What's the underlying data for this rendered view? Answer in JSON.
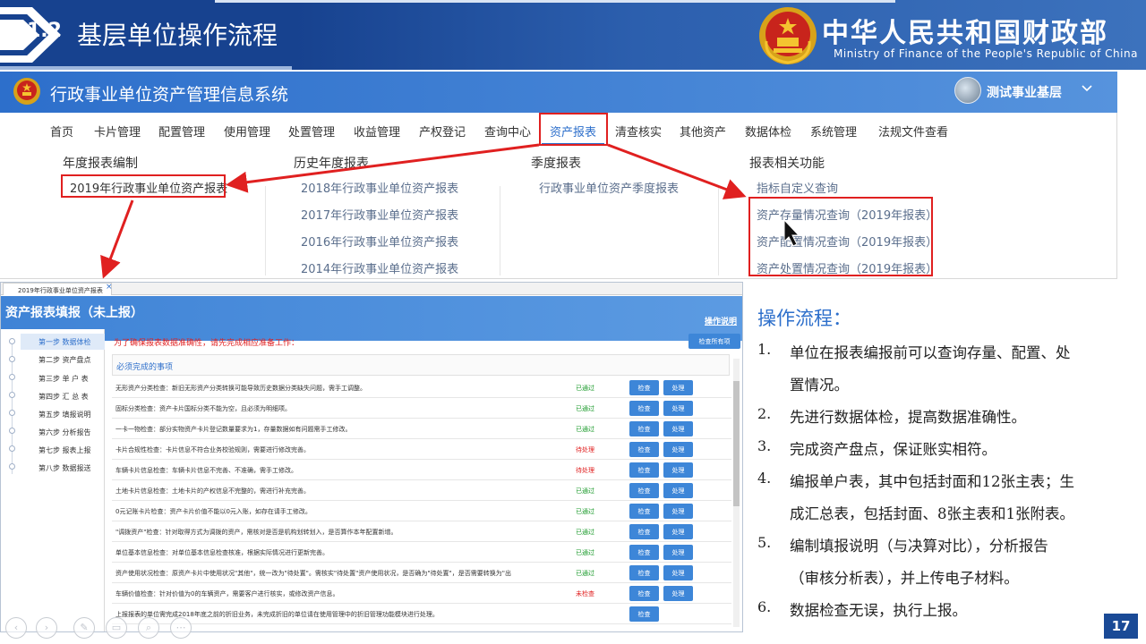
{
  "slide": {
    "section_number": "1.2",
    "section_title": "基层单位操作流程",
    "ministry_cn": "中华人民共和国财政部",
    "ministry_en": "Ministry of Finance of the People's Republic of China",
    "page_number": "17"
  },
  "system": {
    "title": "行政事业单位资产管理信息系统",
    "user_name": "测试事业基层",
    "nav": [
      "首页",
      "卡片管理",
      "配置管理",
      "使用管理",
      "处置管理",
      "收益管理",
      "产权登记",
      "查询中心",
      "资产报表",
      "清查核实",
      "其他资产",
      "数据体检",
      "系统管理",
      "法规文件查看"
    ],
    "active_nav": "资产报表",
    "dropdown": {
      "annual": {
        "heading": "年度报表编制",
        "links": [
          "2019年行政事业单位资产报表"
        ]
      },
      "history": {
        "heading": "历史年度报表",
        "links": [
          "2018年行政事业单位资产报表",
          "2017年行政事业单位资产报表",
          "2016年行政事业单位资产报表",
          "2014年行政事业单位资产报表"
        ]
      },
      "quarterly": {
        "heading": "季度报表",
        "links": [
          "行政事业单位资产季度报表"
        ]
      },
      "related": {
        "heading": "报表相关功能",
        "links": [
          "指标自定义查询",
          "资产存量情况查询（2019年报表）",
          "资产配置情况查询（2019年报表）",
          "资产处置情况查询（2019年报表）"
        ]
      }
    }
  },
  "report": {
    "tab_label": "2019年行政事业单位资产报表",
    "title": "资产报表填报（未上报）",
    "help": "操作说明",
    "warning": "为了确保报表数据准确性，请先完成相应准备工作：",
    "check_all": "检查所有项",
    "section_title": "必须完成的事项",
    "steps": [
      "第一步 数据体检",
      "第二步 资产盘点",
      "第三步 单 户 表",
      "第四步 汇 总 表",
      "第五步 填报说明",
      "第六步 分析报告",
      "第七步 报表上报",
      "第八步 数据报送"
    ],
    "check_label": "检查",
    "handle_label": "处理",
    "rows": [
      {
        "text": "无形资产分类检查：新旧无形资产分类转换可能导致历史数据分类缺失问题，需手工调整。",
        "status": "已通过",
        "status_color": "#1a9a2a",
        "handle": true
      },
      {
        "text": "固标分类检查：资产卡片国标分类不能为空，且必须为明细项。",
        "status": "已通过",
        "status_color": "#1a9a2a",
        "handle": true
      },
      {
        "text": "一卡一物检查：部分实物资产卡片登记数量要求为1，存量数据如有问题需手工修改。",
        "status": "已通过",
        "status_color": "#1a9a2a",
        "handle": true
      },
      {
        "text": "卡片合规性检查：卡片信息不符合业务校验规则，需要进行修改完善。",
        "status": "待处理",
        "status_color": "#e02020",
        "handle": true
      },
      {
        "text": "车辆卡片信息检查：车辆卡片信息不完善、不准确，需手工修改。",
        "status": "待处理",
        "status_color": "#e02020",
        "handle": true
      },
      {
        "text": "土地卡片信息检查：土地卡片的产权信息不完整的，需进行补充完善。",
        "status": "已通过",
        "status_color": "#1a9a2a",
        "handle": true
      },
      {
        "text": "0元记账卡片检查：资产卡片价值不能以0元入账，如存在请手工修改。",
        "status": "已通过",
        "status_color": "#1a9a2a",
        "handle": true
      },
      {
        "text": "\"调拨资产\"检查：针对取得方式为调拨的资产，需核对是否是机构划转划入，是否算作本年配置新增。",
        "status": "已通过",
        "status_color": "#1a9a2a",
        "handle": true
      },
      {
        "text": "单位基本信息检查：对单位基本信息检查核准，根据实际情况进行更新完善。",
        "status": "已通过",
        "status_color": "#1a9a2a",
        "handle": true
      },
      {
        "text": "资产使用状况检查：原资产卡片中使用状况\"其他\"，统一改为\"待处置\"。需核实\"待处置\"资产使用状况，是否确为\"待处置\"，是否需要转换为\"出",
        "status": "已通过",
        "status_color": "#1a9a2a",
        "handle": true
      },
      {
        "text": "车辆价值检查：针对价值为0的车辆资产，需要客户进行核实，或修改资产信息。",
        "status": "未检查",
        "status_color": "#e02020",
        "handle": true
      },
      {
        "text": "上报报表的单位需完成2018年底之前的折旧业务，未完成折旧的单位请在使用管理中的折旧管理功能模块进行处理。",
        "status": "",
        "status_color": "#1a9a2a",
        "handle": false
      }
    ]
  },
  "process": {
    "title": "操作流程：",
    "steps": [
      {
        "num": "1.",
        "lines": [
          "单位在报表编报前可以查询存量、配置、处",
          "置情况。"
        ]
      },
      {
        "num": "2.",
        "lines": [
          "先进行数据体检，提高数据准确性。"
        ]
      },
      {
        "num": "3.",
        "lines": [
          "完成资产盘点，保证账实相符。"
        ]
      },
      {
        "num": "4.",
        "lines": [
          "编报单户表，其中包括封面和12张主表；生",
          "成汇总表，包括封面、8张主表和1张附表。"
        ]
      },
      {
        "num": "5.",
        "lines": [
          "编制填报说明（与决算对比），分析报告",
          "（审核分析表），并上传电子材料。"
        ]
      },
      {
        "num": "6.",
        "lines": [
          "数据检查无误，执行上报。"
        ]
      }
    ]
  },
  "colors": {
    "header_blue": "#17428f",
    "accent": "#2d6fcb",
    "marker_red": "#e02020"
  }
}
